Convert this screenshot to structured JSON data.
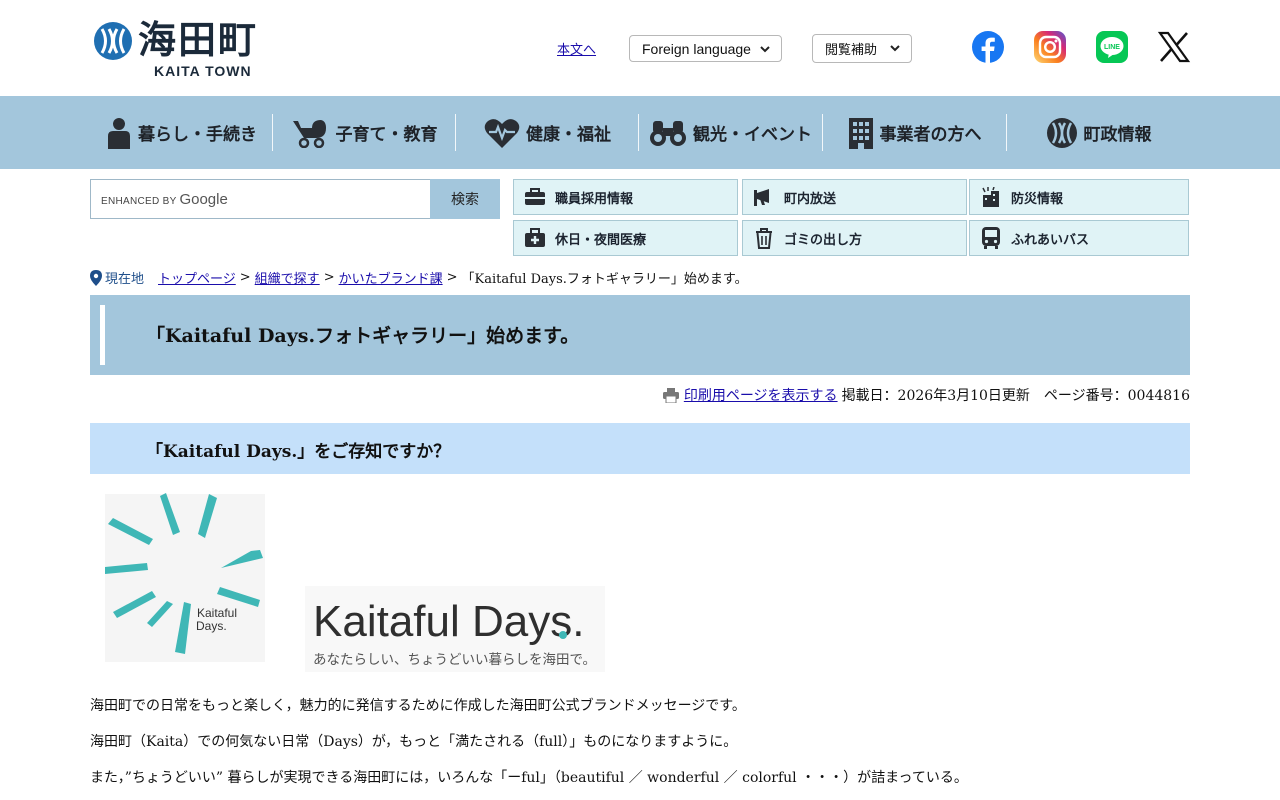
{
  "header": {
    "logo_title": "海田町",
    "logo_sub": "KAITA TOWN",
    "skip_link": "本文へ",
    "foreign_language": "Foreign language",
    "browse_assist": "閲覧補助",
    "sns": [
      "facebook-icon",
      "instagram-icon",
      "line-icon",
      "x-icon"
    ]
  },
  "gnav": {
    "items": [
      {
        "label": "暮らし・手続き",
        "icon": "person-icon"
      },
      {
        "label": "子育て・教育",
        "icon": "stroller-icon"
      },
      {
        "label": "健康・福祉",
        "icon": "heart-icon"
      },
      {
        "label": "観光・イベント",
        "icon": "binoculars-icon"
      },
      {
        "label": "事業者の方へ",
        "icon": "building-icon"
      },
      {
        "label": "町政情報",
        "icon": "town-emblem-icon"
      }
    ]
  },
  "search": {
    "enhanced_by": "ENHANCED BY",
    "google": "Google",
    "button": "検索"
  },
  "quick_links": [
    {
      "label": "職員採用情報",
      "icon": "briefcase-icon"
    },
    {
      "label": "町内放送",
      "icon": "megaphone-icon"
    },
    {
      "label": "防災情報",
      "icon": "disaster-icon"
    },
    {
      "label": "休日・夜間医療",
      "icon": "medical-bag-icon"
    },
    {
      "label": "ゴミの出し方",
      "icon": "trash-icon"
    },
    {
      "label": "ふれあいバス",
      "icon": "bus-icon"
    }
  ],
  "breadcrumb": {
    "here": "現在地",
    "items": [
      "トップページ",
      "組織で探す",
      "かいたブランド課"
    ],
    "current": "「Kaitaful Days.フォトギャラリー」始めます。"
  },
  "page": {
    "title": "「Kaitaful Days.フォトギャラリー」始めます。",
    "print_link": "印刷用ページを表示する",
    "updated": "掲載日：2026年3月10日更新",
    "page_number": "ページ番号：0044816",
    "section_heading": "「Kaitaful Days.」をご存知ですか？"
  },
  "brand": {
    "mark_text_1": "Kaitaful",
    "mark_text_2": "Days.",
    "wordmark": "Kaitaful Days.",
    "tagline": "あなたらしい、ちょうどいい暮らしを海田で。"
  },
  "body": {
    "paragraphs": [
      "海田町での日常をもっと楽しく，魅力的に発信するために作成した海田町公式ブランドメッセージです。",
      "海田町（Kaita）での何気ない日常（Days）が，もっと「満たされる（full）」ものになりますように。",
      "また，”ちょうどいい” 暮らしが実現できる海田町には，いろんな「ーful」（beautiful ／ wonderful ／ colorful ・・・）が詰まっている。"
    ]
  },
  "colors": {
    "nav_bg": "#a3c6dc",
    "quick_bg": "#e0f3f6",
    "heading2_bg": "#c4e0fa",
    "brand_teal": "#3fb7b6",
    "logo_blue": "#1f6fb2"
  }
}
